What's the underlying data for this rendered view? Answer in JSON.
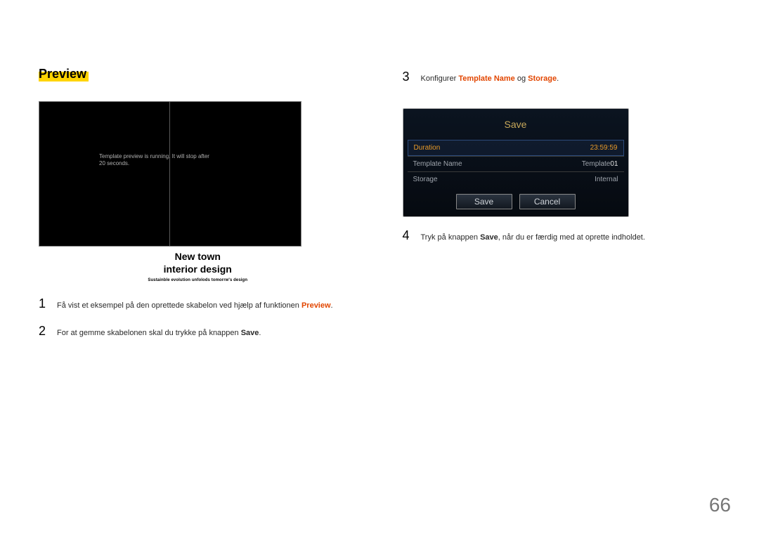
{
  "page_number": "66",
  "left": {
    "heading": "Preview",
    "preview_msg_l1": "Template preview is running. It will stop after",
    "preview_msg_l2": "20 seconds.",
    "caption_l1": "New  town",
    "caption_l2": "interior  design",
    "caption_l3": "Sustainble evolution unfolods tomorrw's design",
    "step1_num": "1",
    "step1_a": "Få vist et eksempel på den oprettede skabelon ved hjælp af funktionen ",
    "step1_hl": "Preview",
    "step1_b": ".",
    "step2_num": "2",
    "step2_a": "For at gemme skabelonen skal du trykke på knappen ",
    "step2_hl": "Save",
    "step2_b": "."
  },
  "right": {
    "step3_num": "3",
    "step3_a": "Konfigurer ",
    "step3_hl1": "Template Name",
    "step3_mid": " og ",
    "step3_hl2": "Storage",
    "step3_b": ".",
    "dialog_title": "Save",
    "rows": {
      "r0_label": "Duration",
      "r0_value": "23:59:59",
      "r1_label": "Template Name",
      "r1_value_a": "Template",
      "r1_value_b": "01",
      "r2_label": "Storage",
      "r2_value": "Internal"
    },
    "btn_save": "Save",
    "btn_cancel": "Cancel",
    "step4_num": "4",
    "step4_a": "Tryk på knappen ",
    "step4_hl": "Save",
    "step4_b": ", når du er færdig med at oprette indholdet."
  }
}
